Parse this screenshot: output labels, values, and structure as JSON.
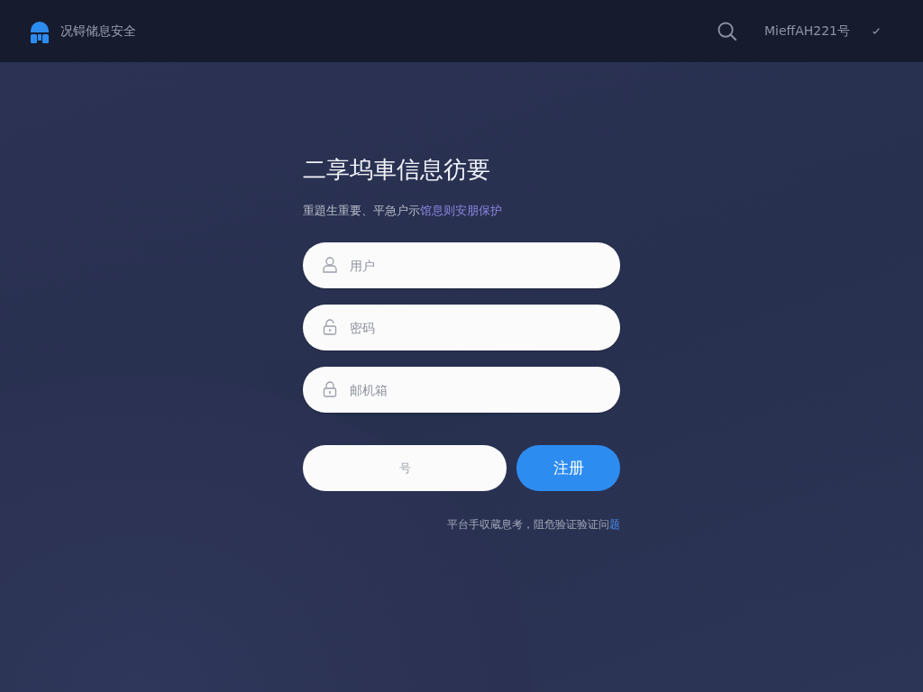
{
  "header": {
    "brand": "况锝储息安全",
    "user": "MieffAH221号"
  },
  "intro": {
    "title": "二享坞車信息彷要",
    "subtitle": "重題生重要、平急户示",
    "subtitle_highlight": "馆息则安朋保护"
  },
  "fields": [
    {
      "kind": "user",
      "placeholder": "用户"
    },
    {
      "kind": "password",
      "placeholder": "密码"
    },
    {
      "kind": "email",
      "placeholder": "邮机箱"
    }
  ],
  "buttons": [
    {
      "kind": "secondary",
      "label": "号"
    },
    {
      "kind": "primary",
      "label": "注册"
    }
  ],
  "footer": {
    "text": "平台手収蔵息考，阻危验证验证问",
    "link": "题"
  }
}
